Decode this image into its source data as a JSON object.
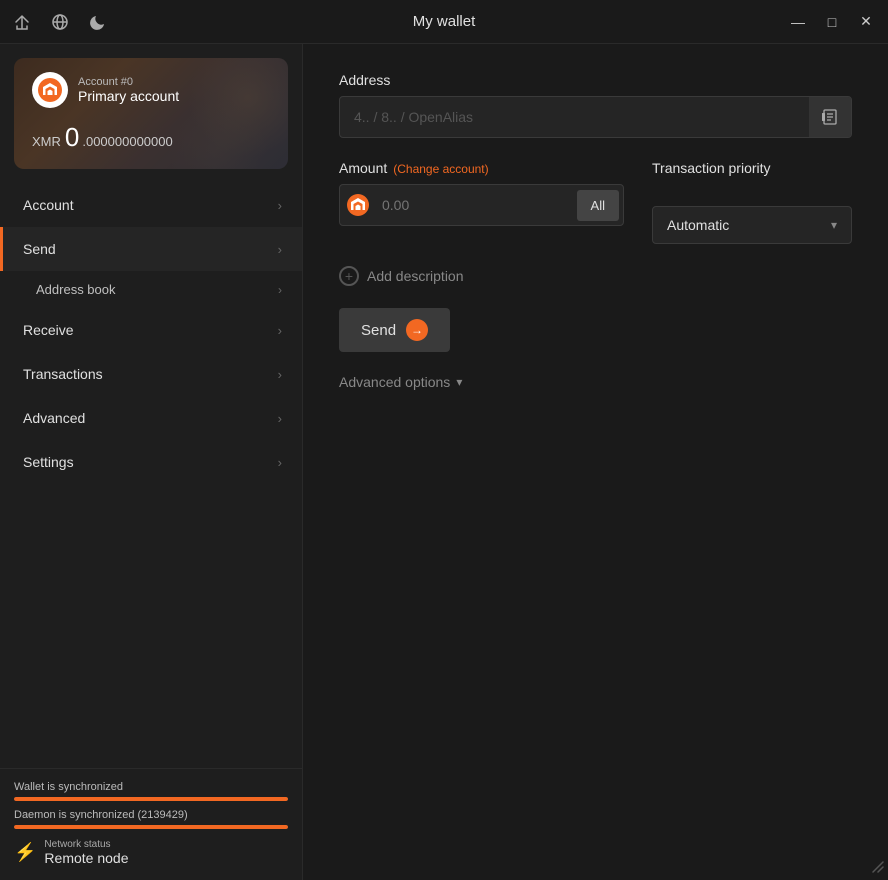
{
  "titlebar": {
    "title": "My wallet",
    "icons": {
      "share": "⇒",
      "globe": "🌐",
      "moon": "🌙"
    },
    "controls": {
      "minimize": "—",
      "maximize": "□",
      "close": "✕"
    }
  },
  "account_card": {
    "account_number": "Account #0",
    "account_name": "Primary account",
    "currency": "XMR",
    "balance_whole": "0",
    "balance_decimal": ".000000000000"
  },
  "nav": {
    "items": [
      {
        "id": "account",
        "label": "Account",
        "active": false
      },
      {
        "id": "send",
        "label": "Send",
        "active": true
      },
      {
        "id": "address-book",
        "label": "Address book",
        "sub": true
      },
      {
        "id": "receive",
        "label": "Receive",
        "active": false
      },
      {
        "id": "transactions",
        "label": "Transactions",
        "active": false
      },
      {
        "id": "advanced",
        "label": "Advanced",
        "active": false
      },
      {
        "id": "settings",
        "label": "Settings",
        "active": false
      }
    ]
  },
  "status": {
    "wallet_sync": "Wallet is synchronized",
    "daemon_sync": "Daemon is synchronized (2139429)",
    "network_label": "Network status",
    "network_value": "Remote node",
    "wallet_bar_pct": 100,
    "daemon_bar_pct": 100
  },
  "send_form": {
    "address_label": "Address",
    "address_placeholder": "4.. / 8.. / OpenAlias",
    "amount_label": "Amount",
    "change_account": "(Change account)",
    "amount_placeholder": "0.00",
    "all_button": "All",
    "priority_label": "Transaction priority",
    "priority_value": "Automatic",
    "add_description": "Add description",
    "send_button": "Send",
    "advanced_options": "Advanced options"
  }
}
